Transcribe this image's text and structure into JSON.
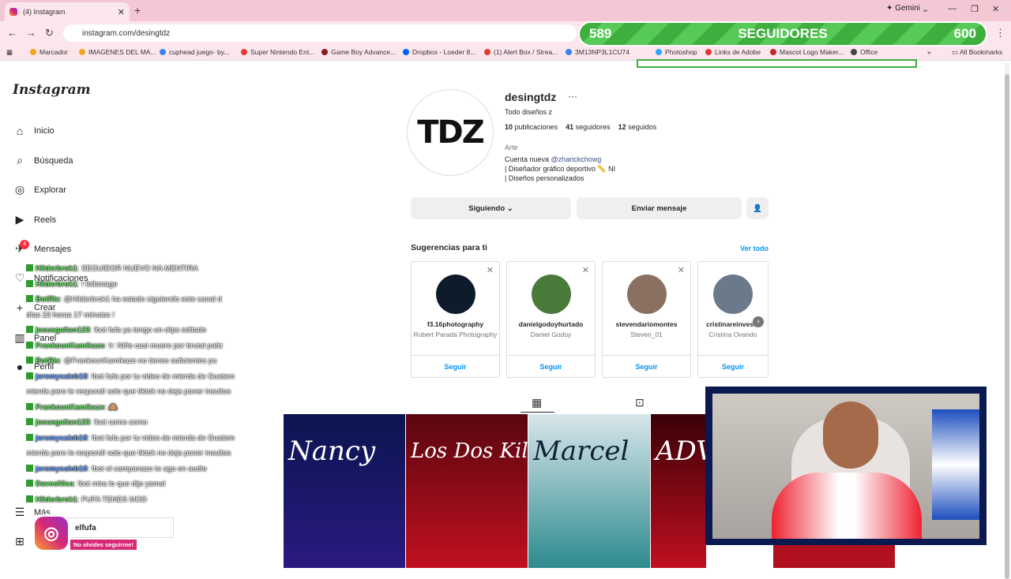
{
  "browser": {
    "tab_title": "(4) Instagram",
    "url": "instagram.com/desingtdz",
    "gemini": "Gemini",
    "all_bookmarks": "All Bookmarks",
    "bookmarks": [
      "Marcador",
      "IMAGENES DEL MA...",
      "cuphead juego- by...",
      "Super Nintendo Ent...",
      "Game Boy Advance...",
      "Dropbox - Loeder 8...",
      "(1) Alert Box / Strea...",
      "3M13NP3L1CU74",
      "Photoshop",
      "Links de Adobe",
      "Mascot Logo Maker...",
      "Office"
    ]
  },
  "overlay": {
    "subs_current": "589",
    "subs_label": "SEGUIDORES",
    "subs_goal": "600"
  },
  "sidebar": {
    "logo": "Instagram",
    "badge": "4",
    "items": [
      {
        "label": "Inicio",
        "icon": "home-icon"
      },
      {
        "label": "Búsqueda",
        "icon": "search-icon"
      },
      {
        "label": "Explorar",
        "icon": "compass-icon"
      },
      {
        "label": "Reels",
        "icon": "reels-icon"
      },
      {
        "label": "Mensajes",
        "icon": "messenger-icon"
      },
      {
        "label": "Notificaciones",
        "icon": "heart-icon"
      },
      {
        "label": "Crear",
        "icon": "plus-icon"
      },
      {
        "label": "Panel",
        "icon": "chart-icon"
      },
      {
        "label": "Perfil",
        "icon": "avatar-icon"
      },
      {
        "label": "Más",
        "icon": "menu-icon"
      },
      {
        "label": "",
        "icon": "apps-icon"
      }
    ]
  },
  "chat": [
    {
      "user": "Hilderbrok1",
      "msg": ": SEGUIDOR NUEVO NA MENTIRA"
    },
    {
      "user": "Hilderbrok1",
      "msg": ": ! followage"
    },
    {
      "user": "BotRix",
      "msg": ": @Hilderbrok1 ha estado siguiendo este canal d"
    },
    {
      "user": "",
      "msg": "días 23 horas 17 minutos !"
    },
    {
      "user": "josuegaitan123",
      "msg": ": !bot fufa ya tengo un clips editado"
    },
    {
      "user": "FrankounKamikaze",
      "msg": ": !r: Niño casi muere por brutal paliz"
    },
    {
      "user": "BotRix",
      "msg": ": @FrankounKamikaze no tienes suficientes pu"
    },
    {
      "user": "jeremycaleb18",
      "msg": ": !bot fufa por tu video de mierda de Guatem"
    },
    {
      "user": "",
      "msg": "mierda pero le respondí solo que tiktok no deja poner insultos"
    },
    {
      "user": "FrankounKamikaze",
      "msg": ": 🙈"
    },
    {
      "user": "josuegaitan123",
      "msg": ": !bot como como"
    },
    {
      "user": "jeremycaleb18",
      "msg": ": !bot fufa por tu video de mierda de Guatem"
    },
    {
      "user": "",
      "msg": "mierda pero le respondí solo que tiktok no deja poner insultos"
    },
    {
      "user": "jeremycaleb18",
      "msg": ": !bot el campanazo te ago en audio"
    },
    {
      "user": "DavesNica",
      "msg": ": !bot mira lo que dijo yamal"
    },
    {
      "user": "Hilderbrok1",
      "msg": ": FUFA TENES MOD"
    }
  ],
  "profile": {
    "avatar_text": "TDZ",
    "username": "desingtdz",
    "more": "···",
    "fullname": "Todo diseños z",
    "posts_n": "10",
    "posts_l": "publicaciones",
    "followers_n": "41",
    "followers_l": "seguidores",
    "following_n": "12",
    "following_l": "seguidos",
    "category": "Arte",
    "bio1_pre": "Cuenta nueva ",
    "bio1_link": "@zharickchowg",
    "bio2": "| Diseñador gráfico deportivo 📏 NI",
    "bio3": "| Diseños personalizados",
    "btn_following": "Siguiendo",
    "btn_message": "Enviar mensaje"
  },
  "suggestions": {
    "title": "Sugerencias para ti",
    "see_all": "Ver todo",
    "follow": "Seguir",
    "cards": [
      {
        "user": "f3.16photography",
        "name": "Robert Parada Photography",
        "color": "#0d1b2a"
      },
      {
        "user": "danielgodoyhurtado",
        "name": "Daniel Godoy",
        "color": "#4a7a3a"
      },
      {
        "user": "stevendariomontes",
        "name": "Steven_01",
        "color": "#8a7060"
      },
      {
        "user": "cristinareinvesto",
        "name": "Cristina Ovando",
        "color": "#6a7a8a"
      }
    ]
  },
  "posts": [
    {
      "title": "Nancy",
      "bg": "linear-gradient(180deg,#0b1550,#2a1a80)"
    },
    {
      "title": "Los Dos Killers",
      "bg": "linear-gradient(180deg,#5a0610,#c0101f)"
    },
    {
      "title": "Marcel",
      "bg": "linear-gradient(180deg,#d8e6ea,#2d8a8e)"
    },
    {
      "title": "ADVAQ",
      "bg": "linear-gradient(180deg,#3a0008,#c01020)"
    }
  ],
  "ig_overlay": {
    "handle": "elfufa",
    "label": "No olvides seguirme!"
  },
  "colors": {
    "link": "#0095f6",
    "chat_user": "#6be36b",
    "subs_bar": "#3fae3f"
  }
}
